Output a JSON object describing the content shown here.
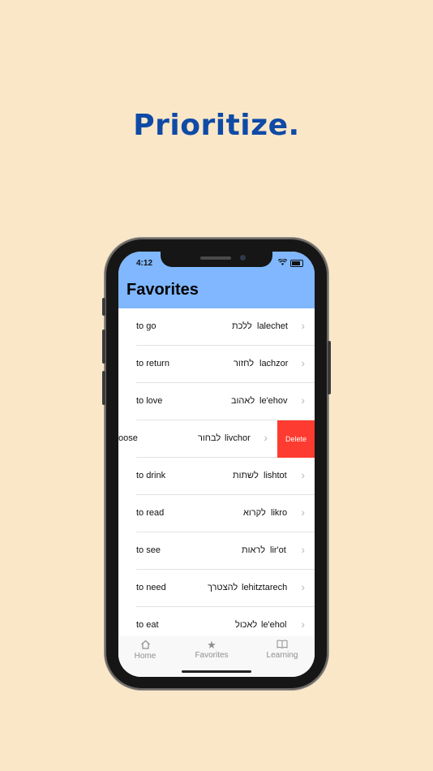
{
  "headline": "Prioritize.",
  "status": {
    "time": "4:12"
  },
  "header": {
    "title": "Favorites"
  },
  "rows": [
    {
      "en": "to go",
      "he": "ללכת",
      "tr": "lalechet"
    },
    {
      "en": "to return",
      "he": "לחזור",
      "tr": "lachzor"
    },
    {
      "en": "to love",
      "he": "לאהוב",
      "tr": "le'ehov"
    },
    {
      "en": "oose",
      "he": "לבחור",
      "tr": "livchor",
      "action": "Delete"
    },
    {
      "en": "to drink",
      "he": "לשתות",
      "tr": "lishtot"
    },
    {
      "en": "to read",
      "he": "לקרוא",
      "tr": "likro"
    },
    {
      "en": "to see",
      "he": "לראות",
      "tr": "lir'ot"
    },
    {
      "en": "to need",
      "he": "להצטרך",
      "tr": "lehitztarech"
    },
    {
      "en": "to eat",
      "he": "לאכול",
      "tr": "le'ehol"
    }
  ],
  "tabs": [
    {
      "label": "Home",
      "icon": "house-icon"
    },
    {
      "label": "Favorites",
      "icon": "star-icon"
    },
    {
      "label": "Learning",
      "icon": "book-icon"
    }
  ],
  "colors": {
    "header": "#80b7fe",
    "delete": "#fe3b30",
    "headline": "#0f4aa6",
    "background": "#f9e7c8"
  }
}
